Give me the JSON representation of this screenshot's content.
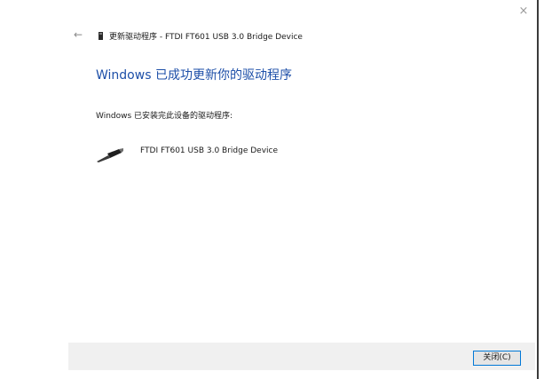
{
  "window": {
    "close_glyph": "×",
    "back_glyph": "←"
  },
  "header": {
    "title": "更新驱动程序 - FTDI FT601 USB 3.0 Bridge Device",
    "icon": "device-icon"
  },
  "main": {
    "heading": "Windows 已成功更新你的驱动程序",
    "installed_text": "Windows 已安装完此设备的驱动程序:",
    "device": {
      "icon": "usb-cable-icon",
      "name": "FTDI FT601 USB 3.0 Bridge Device"
    }
  },
  "footer": {
    "close_label": "关闭(C)"
  },
  "colors": {
    "heading": "#1d4fa8",
    "footer_bg": "#f0f0f0",
    "button_border": "#0078d7"
  }
}
